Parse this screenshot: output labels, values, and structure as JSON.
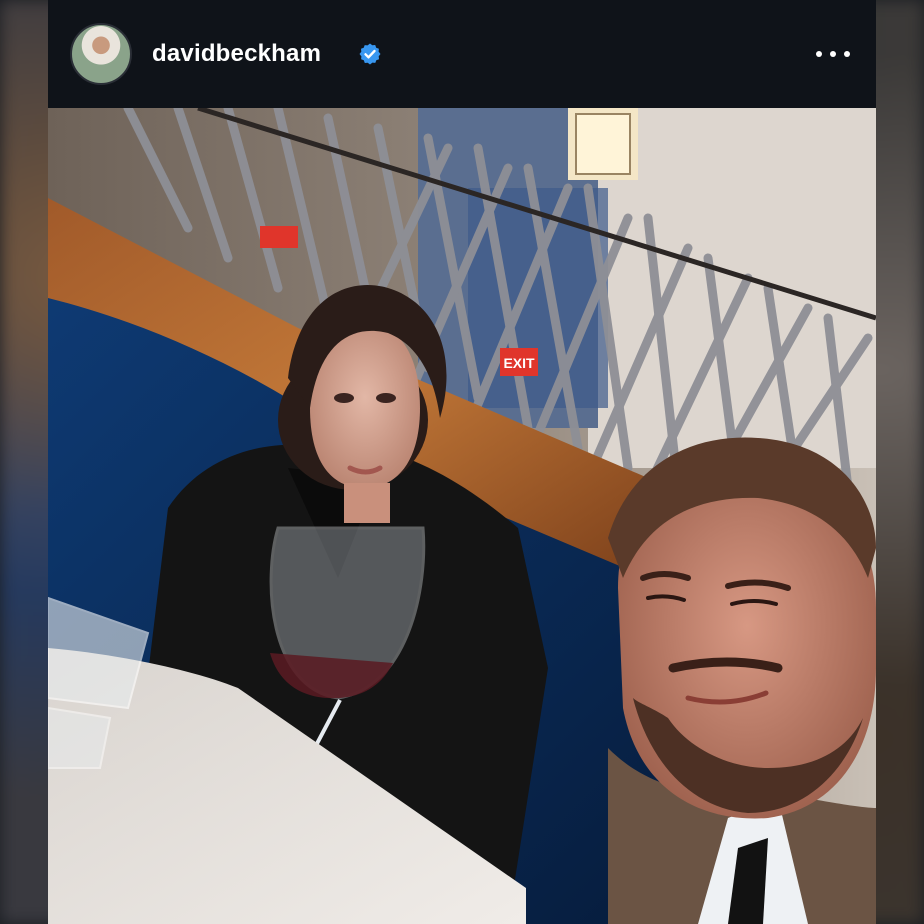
{
  "post": {
    "username": "davidbeckham",
    "verified": true,
    "avatar_icon": "profile-avatar",
    "more_icon": "more-options-icon"
  },
  "photo": {
    "exit_sign": "EXIT"
  },
  "colors": {
    "header_bg": "#0f1319",
    "verified_blue": "#3897f0",
    "text": "#ffffff"
  }
}
